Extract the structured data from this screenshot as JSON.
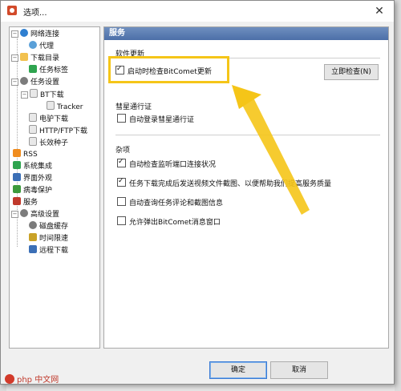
{
  "window": {
    "title": "选项..."
  },
  "tree": {
    "items": [
      {
        "label": "网络连接"
      },
      {
        "label": "代理"
      },
      {
        "label": "下载目录"
      },
      {
        "label": "任务标签"
      },
      {
        "label": "任务设置"
      },
      {
        "label": "BT下载"
      },
      {
        "label": "Tracker"
      },
      {
        "label": "电驴下载"
      },
      {
        "label": "HTTP/FTP下载"
      },
      {
        "label": "长效种子"
      },
      {
        "label": "RSS"
      },
      {
        "label": "系统集成"
      },
      {
        "label": "界面外观"
      },
      {
        "label": "病毒保护"
      },
      {
        "label": "服务"
      },
      {
        "label": "高级设置"
      },
      {
        "label": "磁盘缓存"
      },
      {
        "label": "时间限速"
      },
      {
        "label": "远程下载"
      }
    ]
  },
  "panel": {
    "header": "服务",
    "software_update": {
      "label": "软件更新",
      "auto_check_label": "启动时检查BitComet更新",
      "auto_check_checked": true,
      "check_now_label": "立即检查(N)"
    },
    "passport": {
      "label": "彗星通行证",
      "auto_login_label": "自动登录彗星通行证",
      "auto_login_checked": false
    },
    "misc": {
      "label": "杂项",
      "options": [
        {
          "label": "自动检查监听端口连接状况",
          "checked": true
        },
        {
          "label": "任务下载完成后发送视频文件截图、以便帮助我们提高服务质量",
          "checked": true
        },
        {
          "label": "自动查询任务评论和截图信息",
          "checked": false
        },
        {
          "label": "允许弹出BitComet消息窗口",
          "checked": false
        }
      ]
    }
  },
  "footer": {
    "ok_label": "确定",
    "cancel_label": "取消"
  },
  "watermark": {
    "text": "php 中文网"
  },
  "colors": {
    "highlight": "#f5c518",
    "header_bar": "#4c6fa8"
  }
}
